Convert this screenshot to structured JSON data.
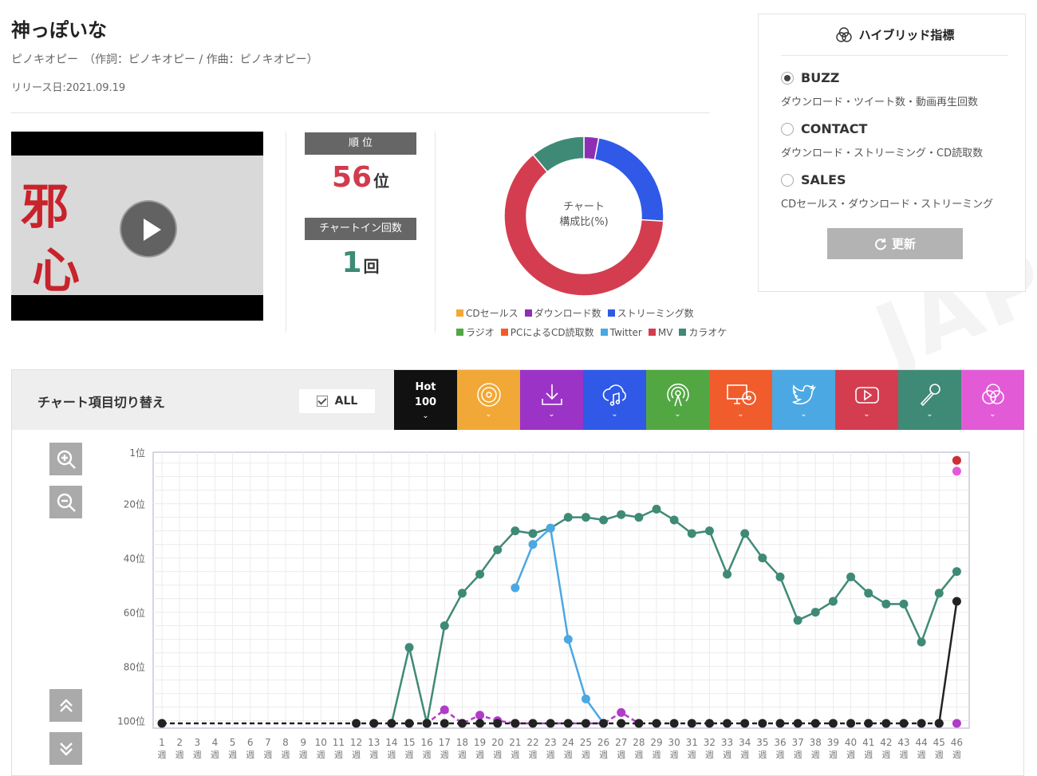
{
  "song": {
    "title": "神っぽいな",
    "artist_line": "ピノキオピー　（作詞：ピノキオピー / 作曲：ピノキオピー）",
    "release": "リリース日:2021.09.19"
  },
  "stats": {
    "rank_label": "順 位",
    "rank_value": "56",
    "rank_unit": "位",
    "chartin_label": "チャートイン回数",
    "chartin_value": "1",
    "chartin_unit": "回"
  },
  "donut": {
    "center_line1": "チャート",
    "center_line2": "構成比(%)",
    "legend": [
      {
        "label": "CDセールス",
        "color": "#f2a836"
      },
      {
        "label": "ダウンロード数",
        "color": "#8e2fb3"
      },
      {
        "label": "ストリーミング数",
        "color": "#2f59e6"
      },
      {
        "label": "ラジオ",
        "color": "#52a743"
      },
      {
        "label": "PCによるCD読取数",
        "color": "#f15c2c"
      },
      {
        "label": "Twitter",
        "color": "#4ba8e2"
      },
      {
        "label": "MV",
        "color": "#d43d4f"
      },
      {
        "label": "カラオケ",
        "color": "#3f8a76"
      }
    ],
    "slices": [
      {
        "name": "ダウンロード数",
        "value": 3,
        "color": "#8e2fb3"
      },
      {
        "name": "ストリーミング数",
        "value": 23,
        "color": "#2f59e6"
      },
      {
        "name": "MV",
        "value": 63,
        "color": "#d43d4f"
      },
      {
        "name": "カラオケ",
        "value": 11,
        "color": "#3f8a76"
      }
    ]
  },
  "watermark": "JAPAN",
  "hybrid": {
    "title": "ハイブリッド指標",
    "options": [
      {
        "label": "BUZZ",
        "desc": "ダウンロード・ツイート数・動画再生回数",
        "selected": true
      },
      {
        "label": "CONTACT",
        "desc": "ダウンロード・ストリーミング・CD読取数",
        "selected": false
      },
      {
        "label": "SALES",
        "desc": "CDセールス・ダウンロード・ストリーミング",
        "selected": false
      }
    ],
    "update_label": "更新"
  },
  "switcher": {
    "title": "チャート項目切り替え",
    "all_label": "ALL",
    "hot_line1": "Hot",
    "hot_line2": "100",
    "tabs": [
      {
        "icon": "cd-icon",
        "color": "#f2a836"
      },
      {
        "icon": "download-icon",
        "color": "#9b33c6"
      },
      {
        "icon": "streaming-icon",
        "color": "#2f59e6"
      },
      {
        "icon": "radio-icon",
        "color": "#52a743"
      },
      {
        "icon": "pc-cd-icon",
        "color": "#f15c2c"
      },
      {
        "icon": "twitter-icon",
        "color": "#4ba8e2"
      },
      {
        "icon": "youtube-icon",
        "color": "#d43d4f"
      },
      {
        "icon": "microphone-icon",
        "color": "#3f8a76"
      },
      {
        "icon": "hybrid-icon",
        "color": "#e35ad7"
      }
    ]
  },
  "chart_data": {
    "type": "line",
    "y_axis_labels": [
      "1位",
      "20位",
      "40位",
      "60位",
      "80位",
      "100位"
    ],
    "y_ticks": [
      1,
      20,
      40,
      60,
      80,
      100
    ],
    "ylim": [
      1,
      101
    ],
    "y_inverted": true,
    "x_unit": "週",
    "categories": [
      1,
      2,
      3,
      4,
      5,
      6,
      7,
      8,
      9,
      10,
      11,
      12,
      13,
      14,
      15,
      16,
      17,
      18,
      19,
      20,
      21,
      22,
      23,
      24,
      25,
      26,
      27,
      28,
      29,
      30,
      31,
      32,
      33,
      34,
      35,
      36,
      37,
      38,
      39,
      40,
      41,
      42,
      43,
      44,
      45,
      46
    ],
    "grid": true,
    "series": [
      {
        "color": "#3f8a76",
        "dashed": false,
        "points": [
          [
            14,
            101
          ],
          [
            15,
            73
          ],
          [
            16,
            101
          ],
          [
            17,
            65
          ],
          [
            18,
            53
          ],
          [
            19,
            46
          ],
          [
            20,
            37
          ],
          [
            21,
            30
          ],
          [
            22,
            31
          ],
          [
            23,
            29
          ],
          [
            24,
            25
          ],
          [
            25,
            25
          ],
          [
            26,
            26
          ],
          [
            27,
            24
          ],
          [
            28,
            25
          ],
          [
            29,
            22
          ],
          [
            30,
            26
          ],
          [
            31,
            31
          ],
          [
            32,
            30
          ],
          [
            33,
            46
          ],
          [
            34,
            31
          ],
          [
            35,
            40
          ],
          [
            36,
            47
          ],
          [
            37,
            63
          ],
          [
            38,
            60
          ],
          [
            39,
            56
          ],
          [
            40,
            47
          ],
          [
            41,
            53
          ],
          [
            42,
            57
          ],
          [
            43,
            57
          ],
          [
            44,
            71
          ],
          [
            45,
            53
          ],
          [
            46,
            45
          ]
        ]
      },
      {
        "color": "#4ba8e2",
        "dashed": false,
        "points": [
          [
            21,
            51
          ],
          [
            22,
            35
          ],
          [
            23,
            29
          ],
          [
            24,
            70
          ],
          [
            25,
            92
          ],
          [
            26,
            101
          ]
        ]
      },
      {
        "color": "#b03cc7",
        "dashed": true,
        "points": [
          [
            15,
            101
          ],
          [
            16,
            101
          ],
          [
            17,
            96
          ],
          [
            18,
            101
          ],
          [
            19,
            98
          ],
          [
            20,
            100
          ],
          [
            21,
            101
          ],
          [
            26,
            101
          ],
          [
            27,
            97
          ],
          [
            28,
            101
          ]
        ]
      },
      {
        "color": "#e35ad7",
        "dashed": false,
        "points": [
          [
            46,
            8
          ]
        ]
      },
      {
        "color": "#cc2f35",
        "dashed": false,
        "points": [
          [
            46,
            4
          ]
        ]
      },
      {
        "color": "#222222",
        "dashed": true,
        "points": [
          [
            1,
            101
          ],
          [
            12,
            101
          ],
          [
            13,
            101
          ],
          [
            14,
            101
          ],
          [
            15,
            101
          ],
          [
            16,
            101
          ],
          [
            17,
            101
          ],
          [
            18,
            101
          ],
          [
            19,
            101
          ],
          [
            20,
            101
          ],
          [
            21,
            101
          ],
          [
            22,
            101
          ],
          [
            23,
            101
          ],
          [
            24,
            101
          ],
          [
            25,
            101
          ],
          [
            26,
            101
          ],
          [
            27,
            101
          ],
          [
            28,
            101
          ],
          [
            29,
            101
          ],
          [
            30,
            101
          ],
          [
            31,
            101
          ],
          [
            32,
            101
          ],
          [
            33,
            101
          ],
          [
            34,
            101
          ],
          [
            35,
            101
          ],
          [
            36,
            101
          ],
          [
            37,
            101
          ],
          [
            38,
            101
          ],
          [
            39,
            101
          ],
          [
            40,
            101
          ],
          [
            41,
            101
          ],
          [
            42,
            101
          ],
          [
            43,
            101
          ],
          [
            44,
            101
          ],
          [
            45,
            101
          ]
        ]
      },
      {
        "color": "#222222",
        "dashed": false,
        "points": [
          [
            45,
            101
          ],
          [
            46,
            56
          ]
        ]
      },
      {
        "color": "#b03cc7",
        "dashed": false,
        "points": [
          [
            46,
            101
          ]
        ]
      }
    ]
  }
}
